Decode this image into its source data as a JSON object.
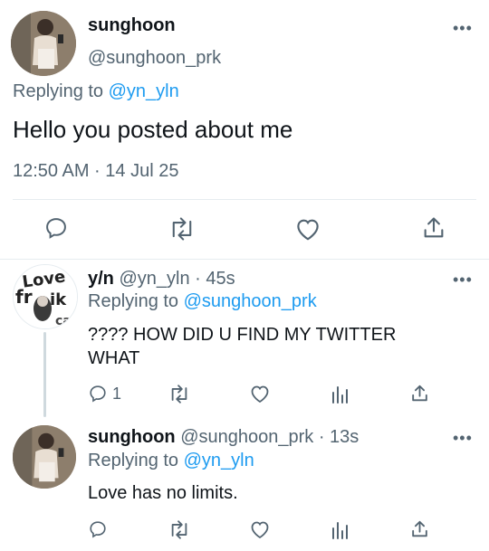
{
  "main_tweet": {
    "display_name": "sunghoon",
    "handle": "@sunghoon_prk",
    "replying_label": "Replying to",
    "replying_to": "@yn_yln",
    "text": "Hello you posted about me",
    "timestamp": "12:50 AM · 14 Jul 25"
  },
  "replies": [
    {
      "display_name": "y/n",
      "handle": "@yn_yln",
      "age": "· 45s",
      "replying_label": "Replying to",
      "replying_to": "@sunghoon_prk",
      "text_line1": "???? HOW DID U FIND MY TWITTER",
      "text_line2": "WHAT",
      "reply_count": "1",
      "avatar_text": "love fr ik"
    },
    {
      "display_name": "sunghoon",
      "handle": "@sunghoon_prk",
      "age": "· 13s",
      "replying_label": "Replying to",
      "replying_to": "@yn_yln",
      "text_line1": "Love has no limits."
    }
  ],
  "icons": {
    "more": "more-horizontal-icon",
    "reply": "speech-bubble-icon",
    "retweet": "retweet-icon",
    "like": "heart-icon",
    "analytics": "bar-chart-icon",
    "share": "share-upload-icon"
  },
  "colors": {
    "link": "#1d9bf0",
    "muted": "#536471",
    "text": "#0f1419"
  }
}
